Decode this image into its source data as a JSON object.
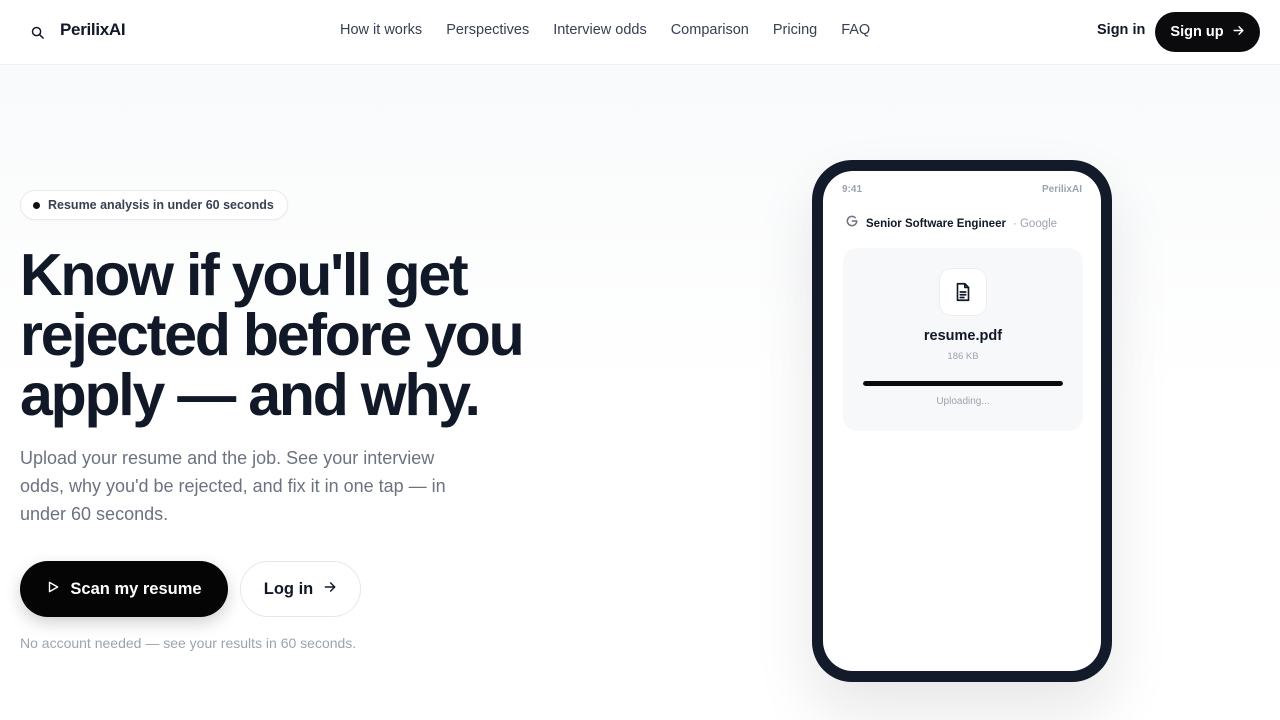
{
  "nav": {
    "brand": "PerilixAI",
    "search_icon": "search-icon",
    "links": [
      "How it works",
      "Perspectives",
      "Interview odds",
      "Comparison",
      "Pricing",
      "FAQ"
    ],
    "signin_label": "Sign in",
    "signup_label": "Sign up",
    "signup_icon": "arrow-right-icon"
  },
  "hero": {
    "badge_text": "Resume analysis in under 60 seconds",
    "headline_lines": [
      "Know if you'll get",
      "rejected before you",
      "apply — and why."
    ],
    "subheadline": "Upload your resume and the job. See your interview odds, why you'd be rejected, and fix it in one tap — in under 60 seconds.",
    "primary_cta": "Scan my resume",
    "primary_cta_icon": "play-icon",
    "secondary_cta": "Log in",
    "secondary_cta_icon": "arrow-right-icon",
    "note": "No account needed — see your results in 60 seconds."
  },
  "phone": {
    "status_time": "9:41",
    "status_app": "PerilixAI",
    "job_title": "Senior Software Engineer",
    "job_company": "· Google",
    "company_icon": "google-icon",
    "file_icon": "document-icon",
    "file_name": "resume.pdf",
    "file_size": "186 KB",
    "upload_progress": 1.0,
    "upload_status": "Uploading..."
  },
  "colors": {
    "primary": "#0b0b0d",
    "text": "#111827",
    "muted": "#6b7280",
    "phone_frame": "#131a2a"
  }
}
